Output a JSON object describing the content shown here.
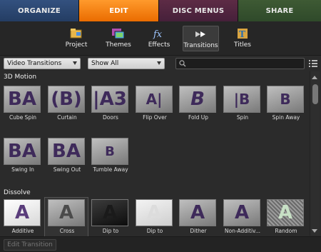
{
  "tabs": [
    {
      "label": "ORGANIZE"
    },
    {
      "label": "EDIT"
    },
    {
      "label": "DISC MENUS"
    },
    {
      "label": "SHARE"
    }
  ],
  "subtabs": [
    {
      "label": "Project",
      "icon": "project-icon"
    },
    {
      "label": "Themes",
      "icon": "themes-icon"
    },
    {
      "label": "Effects",
      "icon": "effects-icon"
    },
    {
      "label": "Transitions",
      "icon": "transitions-icon"
    },
    {
      "label": "Titles",
      "icon": "titles-icon"
    }
  ],
  "filter": {
    "category": "Video Transitions",
    "show": "Show All",
    "search_placeholder": ""
  },
  "sections": {
    "motion": {
      "label": "3D Motion",
      "items": [
        "Cube Spin",
        "Curtain",
        "Doors",
        "Flip Over",
        "Fold Up",
        "Spin",
        "Spin Away",
        "Swing In",
        "Swing Out",
        "Tumble Away"
      ]
    },
    "dissolve": {
      "label": "Dissolve",
      "items": [
        "Additive",
        "Cross",
        "Dip to",
        "Dip to",
        "Dither",
        "Non-Additiv...",
        "Random"
      ]
    }
  },
  "bottom": {
    "edit_label": "Edit Transition"
  },
  "colors": {
    "edit_tab": "#f08010",
    "organize_tab": "#2c4a78",
    "disc_tab": "#52253f",
    "share_tab": "#385232"
  }
}
